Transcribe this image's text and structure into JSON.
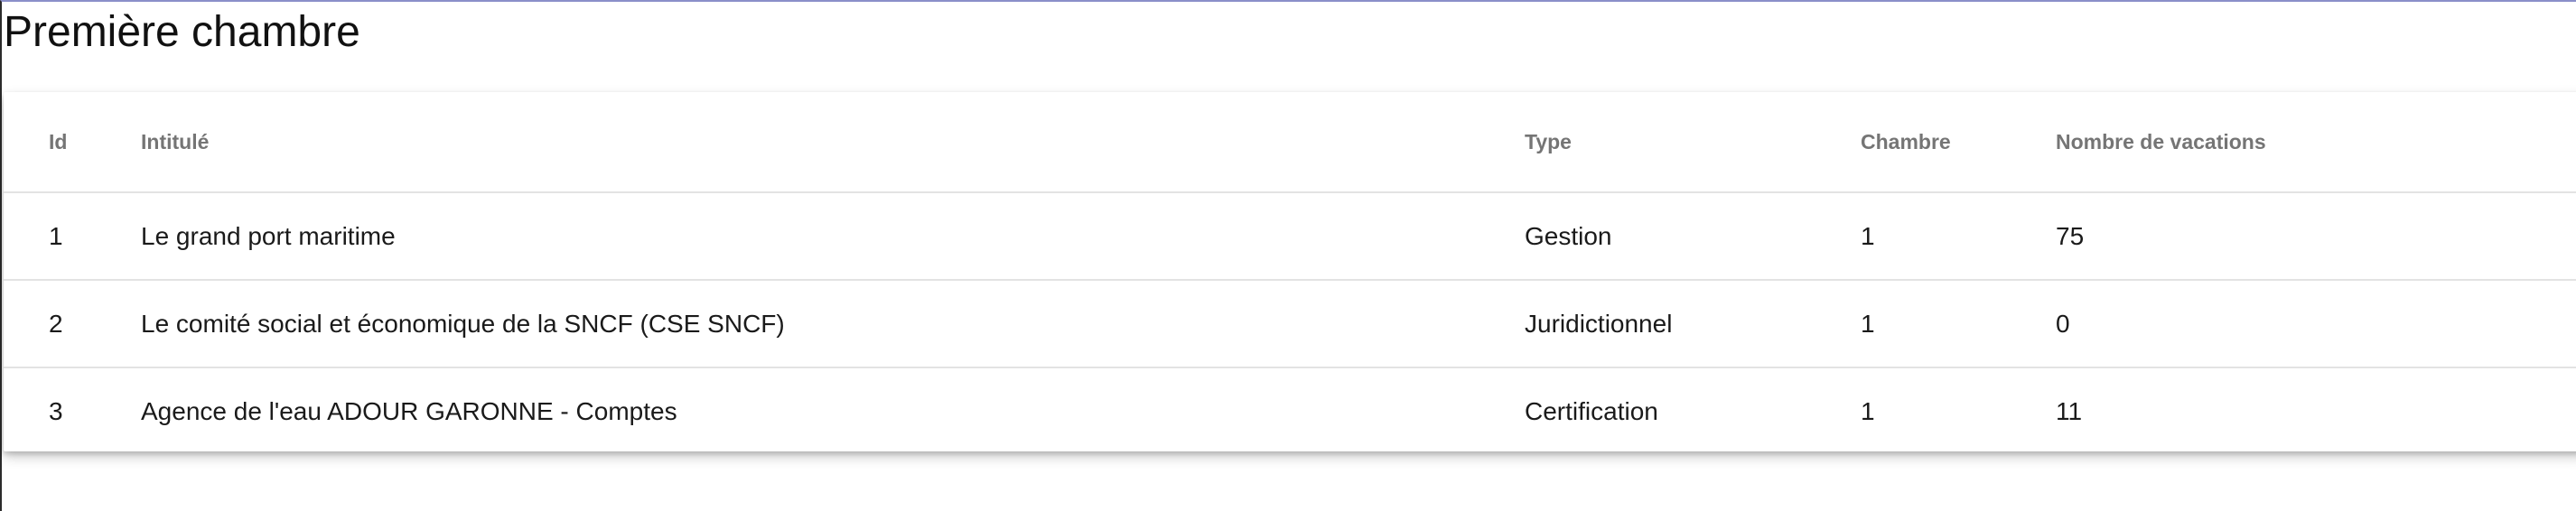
{
  "page": {
    "title": "Première chambre"
  },
  "table": {
    "columns": [
      "Id",
      "Intitulé",
      "Type",
      "Chambre",
      "Nombre de vacations"
    ],
    "rows": [
      [
        "1",
        "Le grand port maritime",
        "Gestion",
        "1",
        "75"
      ],
      [
        "2",
        "Le comité social et économique de la SNCF (CSE SNCF)",
        "Juridictionnel",
        "1",
        "0"
      ],
      [
        "3",
        "Agence de l'eau ADOUR GARONNE - Comptes",
        "Certification",
        "1",
        "11"
      ]
    ]
  },
  "colors": {
    "header_text": "#757575",
    "row_divider": "#e3e3e3",
    "top_border_accent": "#8a8fc9"
  }
}
